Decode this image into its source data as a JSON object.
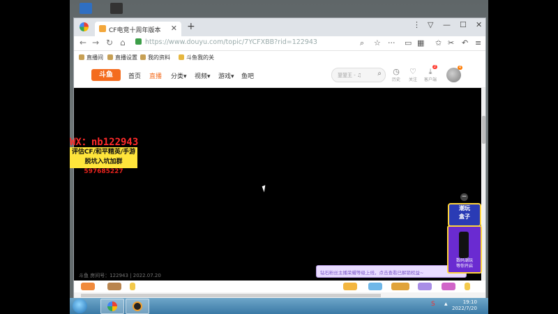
{
  "browser": {
    "tab_title": "CF电竞十周年版本",
    "url": "https://www.douyu.com/topic/7YCFXBB?rid=122943",
    "bookmarks": [
      "直播间",
      "直播设置",
      "我的资料",
      "斗鱼我的关"
    ]
  },
  "site": {
    "logo": "斗鱼",
    "nav": [
      "首页",
      "直播",
      "分类▾",
      "视频▾",
      "游戏▾",
      "鱼吧"
    ],
    "search_placeholder": "翌翌王 - ♫",
    "header_icons": [
      {
        "label": "历史"
      },
      {
        "label": "关注"
      },
      {
        "label": "客户端",
        "badge": "2"
      }
    ],
    "avatar_badge": "4"
  },
  "player": {
    "watermark": "斗鱼 房间号：122943 | 2022.07.20",
    "notice": "钻石粉丝主播荣耀等级上线，点击查看已解锁权益~"
  },
  "promo": {
    "title_line1": "潮玩",
    "title_line2": "盒子",
    "label_line1": "数码潮玩",
    "label_line2": "等你开启"
  },
  "overlay": {
    "wx": "WX：nb122943",
    "line1": "评估CF/和平精英/手游",
    "line2_prefix": "脱坑入坑加群",
    "line2_number": "597685227"
  },
  "taskbar": {
    "time": "19:10",
    "date": "2022/7/20"
  }
}
